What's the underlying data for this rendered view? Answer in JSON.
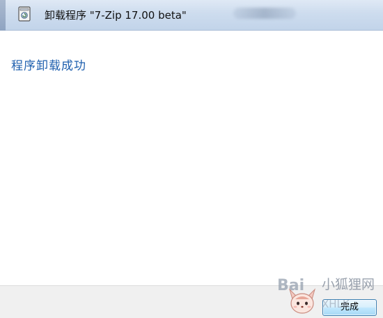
{
  "window": {
    "title": "卸载程序 \"7-Zip 17.00 beta\"",
    "app_icon": "uninstall-icon"
  },
  "content": {
    "message": "程序卸载成功"
  },
  "footer": {
    "finish_label": "完成"
  },
  "watermark": {
    "brand": "Bai",
    "site_cn": "小狐狸网",
    "site_en": "XHLK"
  },
  "colors": {
    "message_text": "#1e5fae",
    "titlebar": "#cddcee",
    "button_border": "#3c7fb1"
  }
}
